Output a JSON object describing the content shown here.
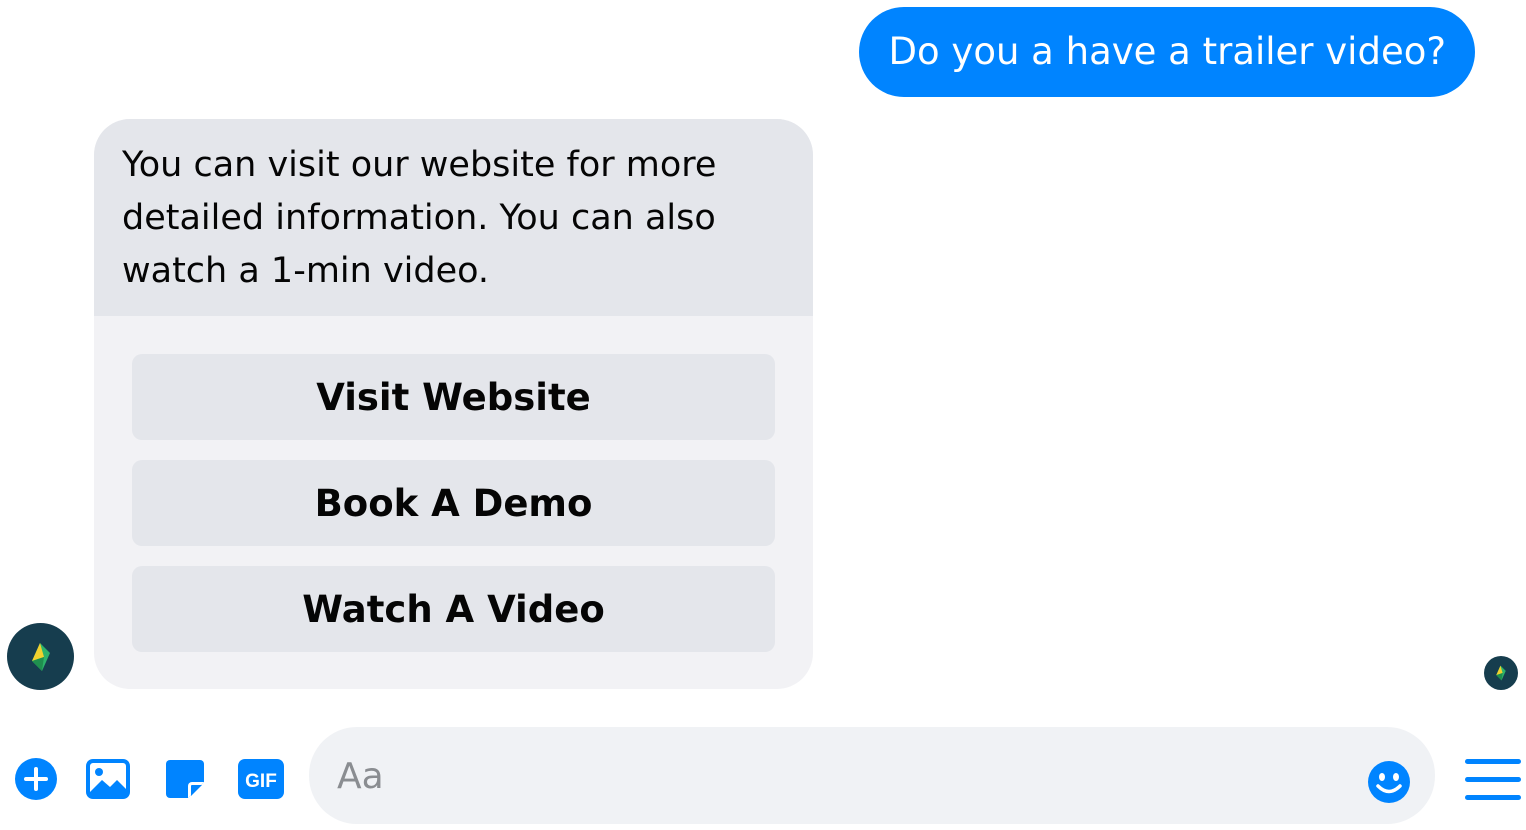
{
  "outgoing_message": {
    "text": "Do you a have a trailer video?"
  },
  "bot_card": {
    "text": "You can visit our website for more detailed information. You can also watch a 1-min video.",
    "buttons": [
      {
        "label": "Visit Website"
      },
      {
        "label": "Book A Demo"
      },
      {
        "label": "Watch A Video"
      }
    ]
  },
  "composer": {
    "placeholder": "Aa",
    "gif_label": "GIF",
    "icons": [
      "plus-icon",
      "image-icon",
      "sticker-icon",
      "gif-icon",
      "emoji-icon",
      "menu-icon"
    ]
  },
  "colors": {
    "accent": "#0084ff",
    "bubble_gray": "#e4e6eb",
    "card_bg": "#f2f2f5",
    "avatar_bg": "#163d4e"
  }
}
